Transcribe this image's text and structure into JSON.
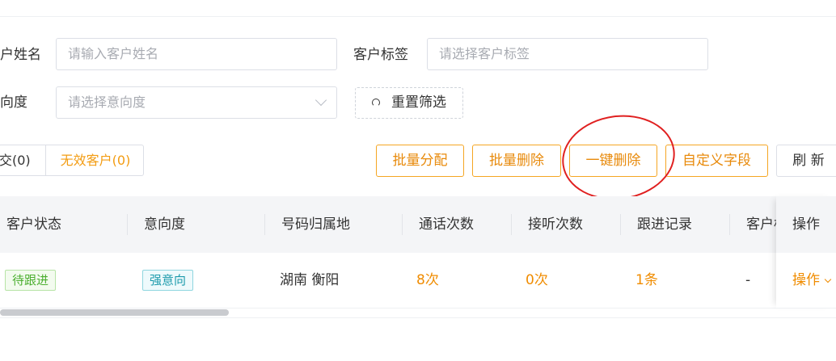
{
  "filters": {
    "name_label": "户姓名",
    "name_placeholder": "请输入客户姓名",
    "tag_label": "客户标签",
    "tag_placeholder": "请选择客户标签",
    "intent_label": "向度",
    "intent_placeholder": "请选择意向度",
    "reset_label": "重置筛选"
  },
  "tabs": [
    {
      "label": "交(0)"
    },
    {
      "label": "无效客户(0)"
    }
  ],
  "toolbar": {
    "batch_assign": "批量分配",
    "batch_delete": "批量删除",
    "one_click_delete": "一键删除",
    "custom_fields": "自定义字段",
    "refresh": "刷 新"
  },
  "table": {
    "columns": [
      "客户状态",
      "意向度",
      "号码归属地",
      "通话次数",
      "接听次数",
      "跟进记录",
      "客户标",
      "操作"
    ],
    "rows": [
      {
        "status": "待跟进",
        "intent": "强意向",
        "location": "湖南 衡阳",
        "calls": "8次",
        "answered": "0次",
        "followups": "1条",
        "tags": "-",
        "action": "操作"
      }
    ]
  },
  "colors": {
    "accent": "#f08c00",
    "status_tag": "#4caf30",
    "intent_tag": "#1b9aab",
    "annotation": "#e02020"
  }
}
